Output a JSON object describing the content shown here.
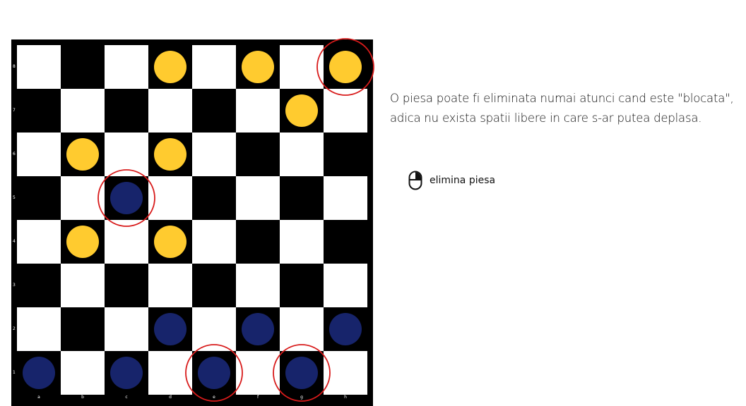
{
  "board": {
    "ranks": [
      "8",
      "7",
      "6",
      "5",
      "4",
      "3",
      "2",
      "1"
    ],
    "files": [
      "a",
      "b",
      "c",
      "d",
      "e",
      "f",
      "g",
      "h"
    ],
    "pieces": [
      {
        "square": "d8",
        "color": "yellow"
      },
      {
        "square": "f8",
        "color": "yellow"
      },
      {
        "square": "h8",
        "color": "yellow"
      },
      {
        "square": "g7",
        "color": "yellow"
      },
      {
        "square": "b6",
        "color": "yellow"
      },
      {
        "square": "d6",
        "color": "yellow"
      },
      {
        "square": "c5",
        "color": "blue"
      },
      {
        "square": "b4",
        "color": "yellow"
      },
      {
        "square": "d4",
        "color": "yellow"
      },
      {
        "square": "d2",
        "color": "blue"
      },
      {
        "square": "f2",
        "color": "blue"
      },
      {
        "square": "h2",
        "color": "blue"
      },
      {
        "square": "a1",
        "color": "blue"
      },
      {
        "square": "c1",
        "color": "blue"
      },
      {
        "square": "e1",
        "color": "blue"
      },
      {
        "square": "g1",
        "color": "blue"
      }
    ],
    "highlighted_squares": [
      "h8",
      "c5",
      "e1",
      "g1"
    ]
  },
  "colors": {
    "light_square": "#ffffff",
    "dark_square": "#000000",
    "yellow_piece": "#ffcb2f",
    "blue_piece": "#17246b",
    "highlight_ring": "#d81b1b"
  },
  "instruction": {
    "text": "O piesa poate fi eliminata numai atunci cand este \"blocata\", adica nu exista spatii libere in care s-ar putea deplasa."
  },
  "mouse_hint": {
    "icon": "mouse-left-click-icon",
    "label": "elimina piesa"
  }
}
